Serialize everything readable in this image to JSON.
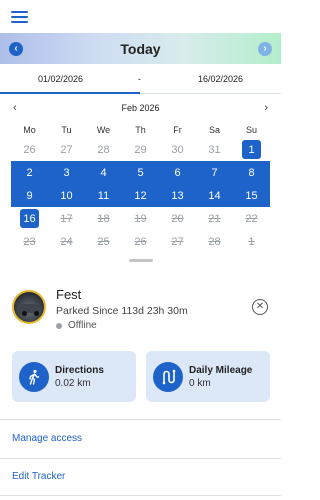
{
  "header": {
    "menu_icon": "hamburger-icon"
  },
  "daybar": {
    "title": "Today",
    "prev_icon": "chevron-left-icon",
    "next_icon": "chevron-right-icon"
  },
  "range": {
    "start": "01/02/2026",
    "separator": "-",
    "end": "16/02/2026"
  },
  "calendar": {
    "month": "Feb 2026",
    "prev": "‹",
    "next": "›",
    "weekdays": [
      "Mo",
      "Tu",
      "We",
      "Th",
      "Fr",
      "Sa",
      "Su"
    ],
    "weeks": [
      [
        "26",
        "27",
        "28",
        "29",
        "30",
        "31",
        "1"
      ],
      [
        "2",
        "3",
        "4",
        "5",
        "6",
        "7",
        "8"
      ],
      [
        "9",
        "10",
        "11",
        "12",
        "13",
        "14",
        "15"
      ],
      [
        "16",
        "17",
        "18",
        "19",
        "20",
        "21",
        "22"
      ],
      [
        "23",
        "24",
        "25",
        "26",
        "27",
        "28",
        "1"
      ]
    ]
  },
  "tracker": {
    "name": "Fest",
    "parked": "Parked Since 113d 23h 30m",
    "status": "Offline",
    "close_icon": "close-circle-icon"
  },
  "cards": [
    {
      "title": "Directions",
      "value": "0.02 km",
      "icon": "walking-person-icon"
    },
    {
      "title": "Daily Mileage",
      "value": "0 km",
      "icon": "route-icon"
    }
  ],
  "links": {
    "manage_access": "Manage access",
    "edit_tracker": "Edit Tracker"
  },
  "colors": {
    "accent": "#1e63c9",
    "card_bg": "#dce7f7"
  }
}
